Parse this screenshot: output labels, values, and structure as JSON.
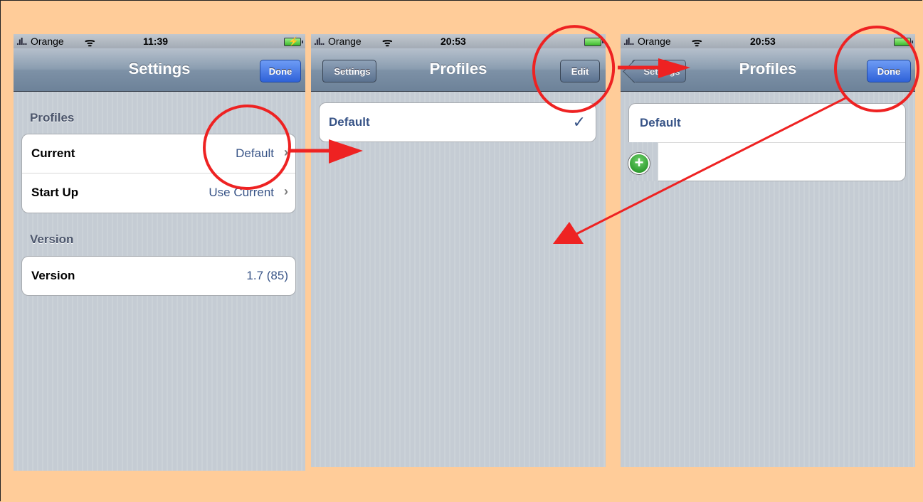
{
  "status": {
    "carrier": "Orange",
    "signal": ".ıl..",
    "wifi": "ᯤ",
    "bolt": "⚡",
    "screen1_time": "11:39",
    "screen2_time": "20:53",
    "screen3_time": "20:53"
  },
  "screen1": {
    "title": "Settings",
    "done_label": "Done",
    "profiles_header": "Profiles",
    "rows": [
      {
        "label": "Current",
        "value": "Default"
      },
      {
        "label": "Start Up",
        "value": "Use Current"
      }
    ],
    "version_header": "Version",
    "version_row": {
      "label": "Version",
      "value": "1.7 (85)"
    }
  },
  "screen2": {
    "back_label": "Settings",
    "title": "Profiles",
    "edit_label": "Edit",
    "profile": "Default",
    "checkmark": "✓"
  },
  "screen3": {
    "back_label": "Settings",
    "title": "Profiles",
    "done_label": "Done",
    "profile": "Default",
    "add_symbol": "+"
  },
  "chevron": "›",
  "colors": {
    "background": "#ffcc99",
    "annotation": "#ee2222",
    "done_button": "#2f62d8",
    "value_text": "#385487"
  }
}
